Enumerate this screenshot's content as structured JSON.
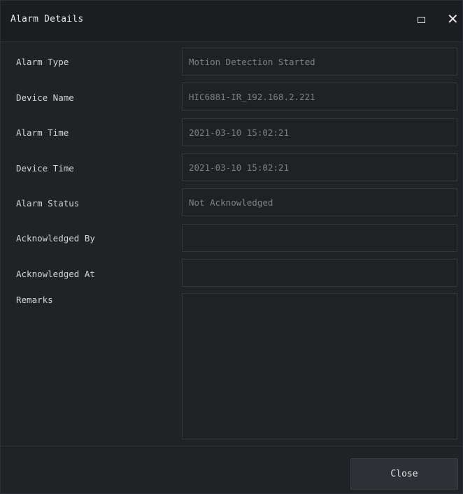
{
  "window": {
    "title": "Alarm Details",
    "maximize_icon": "maximize-icon",
    "close_icon": "close-icon"
  },
  "form": {
    "alarm_type": {
      "label": "Alarm Type",
      "value": "Motion Detection Started"
    },
    "device_name": {
      "label": "Device Name",
      "value": "HIC6881-IR_192.168.2.221"
    },
    "alarm_time": {
      "label": "Alarm Time",
      "value": "2021-03-10 15:02:21"
    },
    "device_time": {
      "label": "Device Time",
      "value": "2021-03-10 15:02:21"
    },
    "alarm_status": {
      "label": "Alarm Status",
      "value": "Not Acknowledged"
    },
    "acknowledged_by": {
      "label": "Acknowledged By",
      "value": ""
    },
    "acknowledged_at": {
      "label": "Acknowledged At",
      "value": ""
    },
    "remarks": {
      "label": "Remarks",
      "value": ""
    }
  },
  "footer": {
    "close_label": "Close"
  },
  "colors": {
    "background": "#202226",
    "titlebar": "#1b1d20",
    "field_border": "#34373c",
    "label_text": "#d2d5d9",
    "value_text": "#7d8186"
  }
}
